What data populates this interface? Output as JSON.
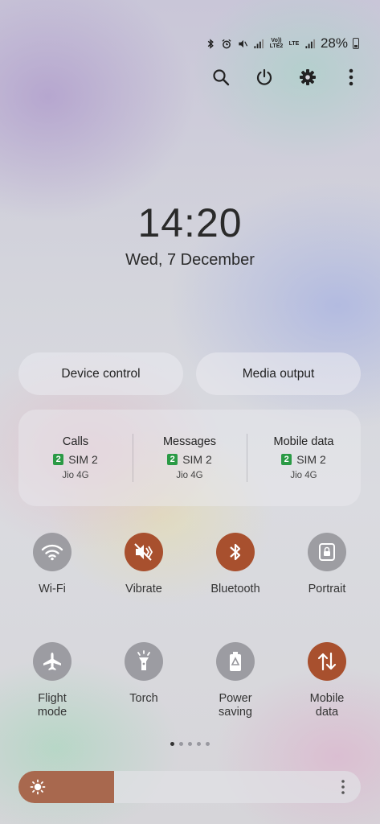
{
  "status_bar": {
    "volte_label": "Vo)) LTE2",
    "lte_label": "LTE",
    "battery_percent": "28%",
    "icons": [
      "bluetooth-icon",
      "alarm-icon",
      "mute-vibrate-icon",
      "signal-icon",
      "volte-icon",
      "lte-icon",
      "signal-icon",
      "battery-icon"
    ]
  },
  "top_actions": [
    "search-icon",
    "power-icon",
    "settings-gear-icon",
    "more-vertical-icon"
  ],
  "clock": {
    "time": "14:20",
    "date": "Wed, 7 December"
  },
  "pills": {
    "device_control": "Device control",
    "media_output": "Media output"
  },
  "sim_panel": [
    {
      "title": "Calls",
      "sim_number": "2",
      "sim_label": "SIM 2",
      "operator": "Jio 4G"
    },
    {
      "title": "Messages",
      "sim_number": "2",
      "sim_label": "SIM 2",
      "operator": "Jio 4G"
    },
    {
      "title": "Mobile data",
      "sim_number": "2",
      "sim_label": "SIM 2",
      "operator": "Jio 4G"
    }
  ],
  "tiles": [
    {
      "label": "Wi-Fi",
      "state": "off",
      "icon": "wifi-icon"
    },
    {
      "label": "Vibrate",
      "state": "on",
      "icon": "vibrate-icon"
    },
    {
      "label": "Bluetooth",
      "state": "on",
      "icon": "bluetooth-icon"
    },
    {
      "label": "Portrait",
      "state": "off",
      "icon": "portrait-lock-icon"
    },
    {
      "label": "Flight\nmode",
      "state": "off",
      "icon": "airplane-icon"
    },
    {
      "label": "Torch",
      "state": "off",
      "icon": "torch-icon"
    },
    {
      "label": "Power\nsaving",
      "state": "off",
      "icon": "power-saving-icon"
    },
    {
      "label": "Mobile\ndata",
      "state": "on",
      "icon": "mobile-data-icon"
    }
  ],
  "page_indicator": {
    "pages": 5,
    "active": 0
  },
  "brightness": {
    "level": 0.28
  },
  "colors": {
    "accent_on": "#a8502e",
    "tile_off": "#96969b",
    "sim_badge": "#2a9a45",
    "brightness_fill": "#a8684e"
  }
}
